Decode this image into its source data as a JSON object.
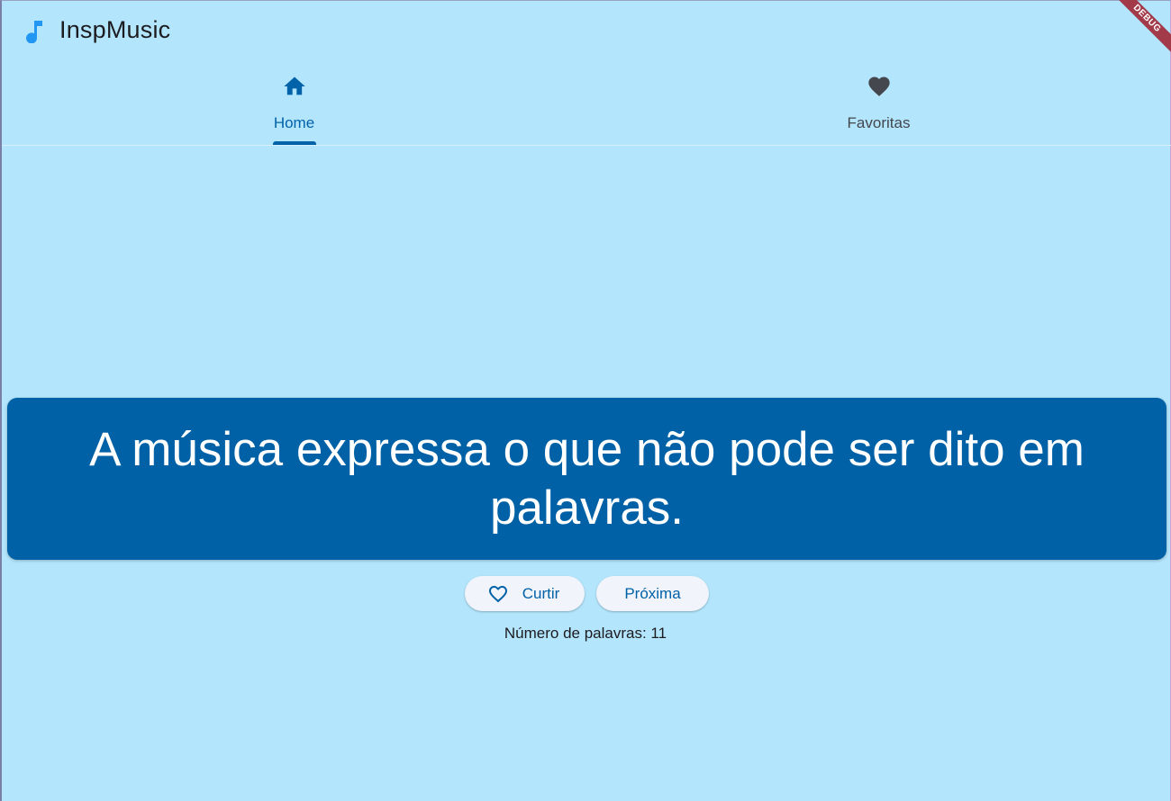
{
  "app": {
    "title": "InspMusic",
    "icon": "music-note-icon",
    "debug_banner": "DEBUG"
  },
  "tabs": [
    {
      "label": "Home",
      "icon": "home-icon",
      "selected": true
    },
    {
      "label": "Favoritas",
      "icon": "heart-icon",
      "selected": false
    }
  ],
  "quote": {
    "text": "A música expressa o que não pode ser dito em palavras."
  },
  "actions": {
    "like_label": "Curtir",
    "like_icon": "heart-outline-icon",
    "next_label": "Próxima"
  },
  "stats": {
    "word_count_text": "Número de palavras: 11"
  },
  "colors": {
    "background": "#b3e5fc",
    "primary": "#0061a6",
    "accent_icon": "#2196f3",
    "debug": "#a33a4a"
  }
}
